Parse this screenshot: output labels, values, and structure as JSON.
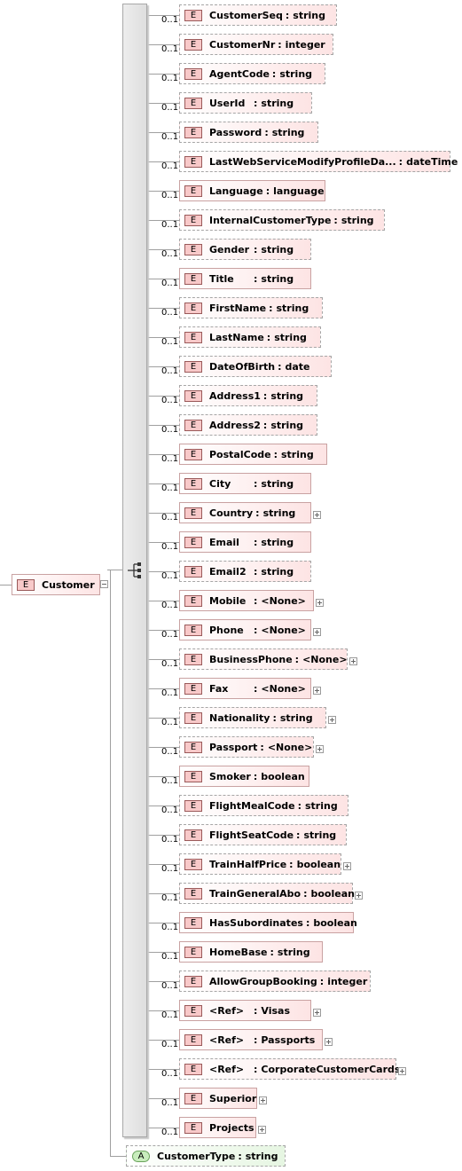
{
  "root": {
    "badge": "E",
    "name": "Customer"
  },
  "elements": [
    {
      "card": "0..1",
      "badge": "E",
      "name": "CustomerSeq",
      "type": "string",
      "expand": false
    },
    {
      "card": "0..1",
      "badge": "E",
      "name": "CustomerNr",
      "type": "integer",
      "expand": false
    },
    {
      "card": "0..1",
      "badge": "E",
      "name": "AgentCode",
      "type": "string",
      "expand": false
    },
    {
      "card": "0..1",
      "badge": "E",
      "name": "UserId",
      "type": "string",
      "expand": false
    },
    {
      "card": "0..1",
      "badge": "E",
      "name": "Password",
      "type": "string",
      "expand": false
    },
    {
      "card": "0..1",
      "badge": "E",
      "name": "LastWebServiceModifyProfileDa...",
      "type": "dateTime",
      "expand": false
    },
    {
      "card": "0..1",
      "badge": "E",
      "name": "Language",
      "type": "language",
      "expand": false
    },
    {
      "card": "0..1",
      "badge": "E",
      "name": "InternalCustomerType",
      "type": "string",
      "expand": false
    },
    {
      "card": "0..1",
      "badge": "E",
      "name": "Gender",
      "type": "string",
      "expand": false
    },
    {
      "card": "0..1",
      "badge": "E",
      "name": "Title",
      "type": "string",
      "expand": false
    },
    {
      "card": "0..1",
      "badge": "E",
      "name": "FirstName",
      "type": "string",
      "expand": false
    },
    {
      "card": "0..1",
      "badge": "E",
      "name": "LastName",
      "type": "string",
      "expand": false
    },
    {
      "card": "0..1",
      "badge": "E",
      "name": "DateOfBirth",
      "type": "date",
      "expand": false
    },
    {
      "card": "0..1",
      "badge": "E",
      "name": "Address1",
      "type": "string",
      "expand": false
    },
    {
      "card": "0..1",
      "badge": "E",
      "name": "Address2",
      "type": "string",
      "expand": false
    },
    {
      "card": "0..1",
      "badge": "E",
      "name": "PostalCode",
      "type": "string",
      "expand": false
    },
    {
      "card": "0..1",
      "badge": "E",
      "name": "City",
      "type": "string",
      "expand": false
    },
    {
      "card": "0..1",
      "badge": "E",
      "name": "Country",
      "type": "string",
      "expand": true
    },
    {
      "card": "0..1",
      "badge": "E",
      "name": "Email",
      "type": "string",
      "expand": false
    },
    {
      "card": "0..1",
      "badge": "E",
      "name": "Email2",
      "type": "string",
      "expand": false
    },
    {
      "card": "0..1",
      "badge": "E",
      "name": "Mobile",
      "type": "<None>",
      "expand": true
    },
    {
      "card": "0..1",
      "badge": "E",
      "name": "Phone",
      "type": "<None>",
      "expand": true
    },
    {
      "card": "0..1",
      "badge": "E",
      "name": "BusinessPhone",
      "type": "<None>",
      "expand": true
    },
    {
      "card": "0..1",
      "badge": "E",
      "name": "Fax",
      "type": "<None>",
      "expand": true
    },
    {
      "card": "0..1",
      "badge": "E",
      "name": "Nationality",
      "type": "string",
      "expand": true
    },
    {
      "card": "0..1",
      "badge": "E",
      "name": "Passport",
      "type": "<None>",
      "expand": true
    },
    {
      "card": "0..1",
      "badge": "E",
      "name": "Smoker",
      "type": "boolean",
      "expand": false
    },
    {
      "card": "0..1",
      "badge": "E",
      "name": "FlightMealCode",
      "type": "string",
      "expand": false
    },
    {
      "card": "0..1",
      "badge": "E",
      "name": "FlightSeatCode",
      "type": "string",
      "expand": false
    },
    {
      "card": "0..1",
      "badge": "E",
      "name": "TrainHalfPrice",
      "type": "boolean",
      "expand": true
    },
    {
      "card": "0..1",
      "badge": "E",
      "name": "TrainGeneralAbo",
      "type": "boolean",
      "expand": true
    },
    {
      "card": "0..1",
      "badge": "E",
      "name": "HasSubordinates",
      "type": "boolean",
      "expand": false
    },
    {
      "card": "0..1",
      "badge": "E",
      "name": "HomeBase",
      "type": "string",
      "expand": false
    },
    {
      "card": "0..1",
      "badge": "E",
      "name": "AllowGroupBooking",
      "type": "integer",
      "expand": false
    },
    {
      "card": "0..1",
      "badge": "E",
      "name": "<Ref>",
      "type": "Visas",
      "expand": true
    },
    {
      "card": "0..1",
      "badge": "E",
      "name": "<Ref>",
      "type": "Passports",
      "expand": true
    },
    {
      "card": "0..1",
      "badge": "E",
      "name": "<Ref>",
      "type": "CorporateCustomerCards",
      "expand": true
    },
    {
      "card": "0..1",
      "badge": "E",
      "name": "Superior",
      "type": "",
      "expand": true
    },
    {
      "card": "0..1",
      "badge": "E",
      "name": "Projects",
      "type": "",
      "expand": true
    }
  ],
  "attribute": {
    "badge": "A",
    "name": "CustomerType",
    "type": "string"
  }
}
